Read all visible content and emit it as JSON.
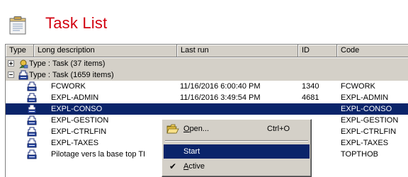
{
  "header": {
    "title": "Task List",
    "icon": "list-document-icon"
  },
  "columns": [
    "Type",
    "Long description",
    "Last run",
    "ID",
    "Code"
  ],
  "groups": [
    {
      "label": "Type : Task (37 items)",
      "expanded": false,
      "icon": "task-group-icon"
    },
    {
      "label": "Type : Task (1659 items)",
      "expanded": true,
      "icon": "task-icon"
    }
  ],
  "rows": [
    {
      "description": "FCWORK",
      "last_run": "11/16/2016 6:00:40 PM",
      "id": "1340",
      "code": "FCWORK",
      "selected": false
    },
    {
      "description": "EXPL-ADMIN",
      "last_run": "11/16/2016 3:49:54 PM",
      "id": "4681",
      "code": "EXPL-ADMIN",
      "selected": false
    },
    {
      "description": "EXPL-CONSO",
      "last_run": "",
      "id": "",
      "code": "EXPL-CONSO",
      "selected": true
    },
    {
      "description": "EXPL-GESTION",
      "last_run": "",
      "id": "",
      "code": "EXPL-GESTION",
      "selected": false
    },
    {
      "description": "EXPL-CTRLFIN",
      "last_run": "",
      "id": "",
      "code": "EXPL-CTRLFIN",
      "selected": false
    },
    {
      "description": "EXPL-TAXES",
      "last_run": "",
      "id": "",
      "code": "EXPL-TAXES",
      "selected": false
    },
    {
      "description": "Pilotage vers la base top TI",
      "last_run": "",
      "id": "",
      "code": "TOPTHOB",
      "selected": false
    }
  ],
  "context_menu": {
    "open_label": "Open...",
    "open_shortcut": "Ctrl+O",
    "start_label": "Start",
    "active_label": "Active",
    "active_checked": true
  },
  "colors": {
    "title": "#d2000f",
    "selection": "#0a246a",
    "chrome": "#d4d0c8"
  }
}
